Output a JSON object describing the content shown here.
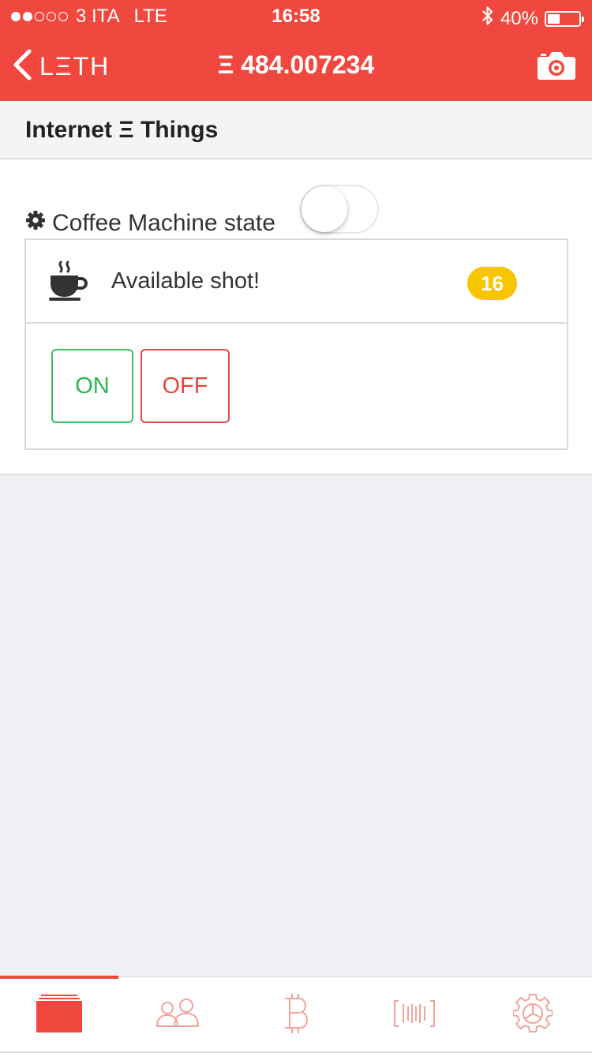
{
  "status_bar": {
    "carrier": "3 ITA",
    "network": "LTE",
    "time": "16:58",
    "battery": "40%",
    "battery_level": 0.4,
    "signal_bars": 2,
    "signal_max": 5
  },
  "nav": {
    "back_label": "LΞTH",
    "balance": "Ξ 484.007234",
    "camera_icon": "camera-icon",
    "color": "#f0483e"
  },
  "section": {
    "title": "Internet Ξ Things"
  },
  "device": {
    "state_label": "Coffee Machine state",
    "state_on": false,
    "shot_label": "Available shot!",
    "shot_count": "16",
    "on_label": "ON",
    "off_label": "OFF"
  },
  "tabbar": {
    "active_index": 0,
    "tabs": [
      {
        "icon": "cards-icon"
      },
      {
        "icon": "contacts-icon"
      },
      {
        "icon": "bitcoin-icon"
      },
      {
        "icon": "barcode-icon"
      },
      {
        "icon": "settings-icon"
      }
    ]
  }
}
